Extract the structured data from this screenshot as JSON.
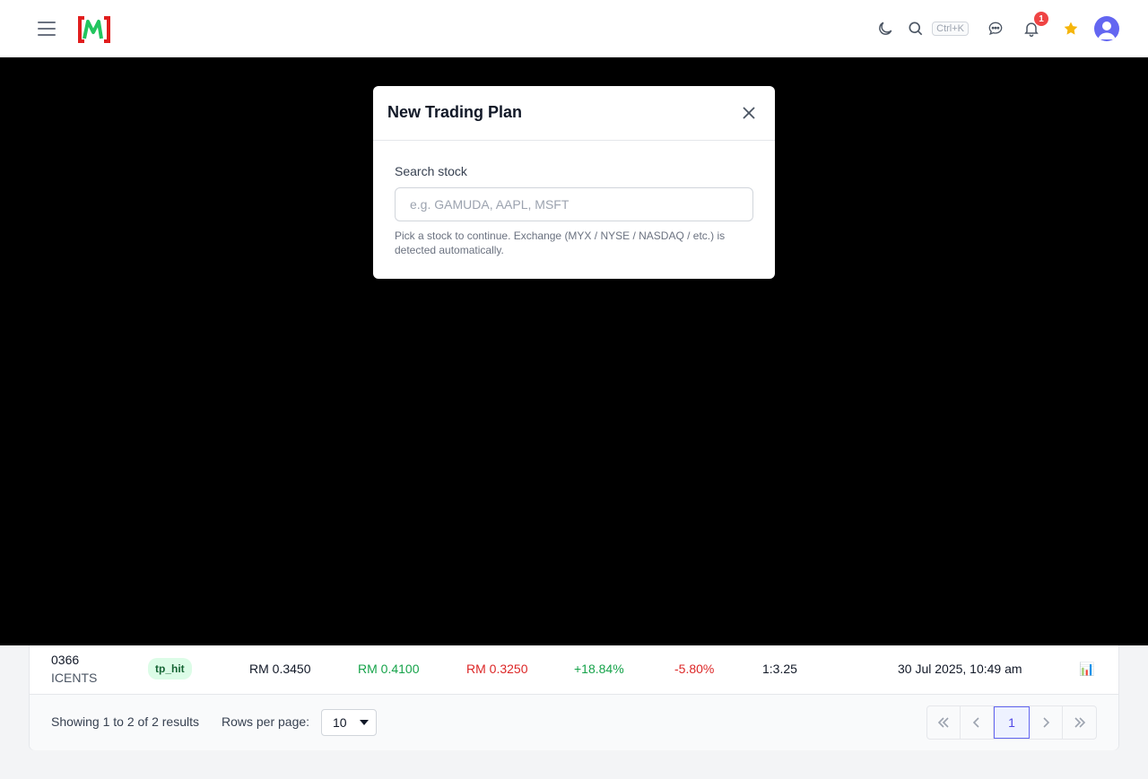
{
  "navbar": {
    "search_shortcut": "Ctrl+K",
    "notification_count": "1"
  },
  "modal": {
    "title": "New Trading Plan",
    "search_label": "Search stock",
    "search_placeholder": "e.g. GAMUDA, AAPL, MSFT",
    "search_value": "",
    "help_text": "Pick a stock to continue. Exchange (MYX / NYSE / NASDAQ / etc.) is detected automatically."
  },
  "table": {
    "rows": [
      {
        "code": "0366",
        "name": "ICENTS",
        "status": "tp_hit",
        "entry": "RM 0.3450",
        "take_profit": "RM 0.4100",
        "stop_loss": "RM 0.3250",
        "gain_pct": "+18.84%",
        "loss_pct": "-5.80%",
        "risk_reward": "1:3.25",
        "created": "30 Jul 2025, 10:49 am",
        "action_icon": "📊"
      }
    ],
    "footer": {
      "showing": "Showing 1 to 2 of 2 results",
      "rows_per_page_label": "Rows per page:",
      "rows_per_page_value": "10",
      "current_page": "1"
    }
  },
  "colors": {
    "overlay": "#000000",
    "accent": "#6366f1",
    "positive": "#16a34a",
    "negative": "#dc2626",
    "badge": "#ef4444",
    "favorite_star": "#f5b50a"
  }
}
